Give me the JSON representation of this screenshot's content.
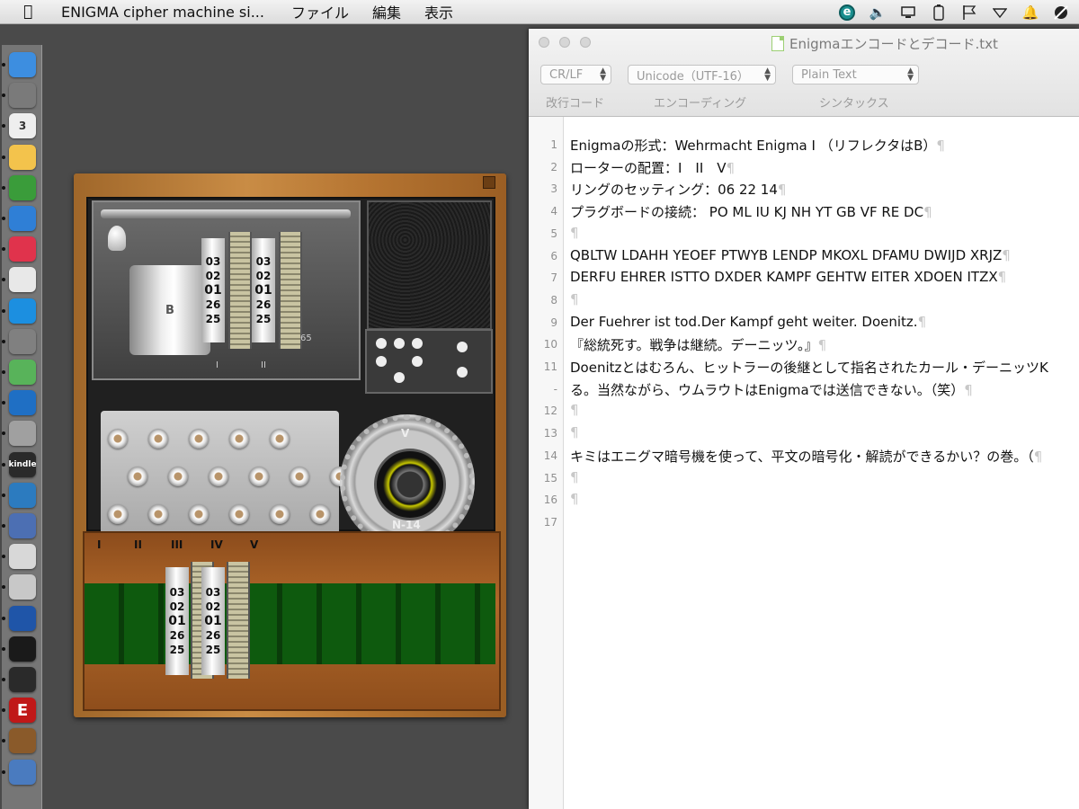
{
  "menubar": {
    "app_name": "ENIGMA cipher machine si...",
    "menus": [
      "ファイル",
      "編集",
      "表示"
    ]
  },
  "tray_icons": [
    "e-status-icon",
    "volume-icon",
    "monitor-icon",
    "battery-icon",
    "flag-icon",
    "wifi-icon",
    "notification-bell-icon",
    "user-tools-icon"
  ],
  "dock": {
    "apps": [
      "finder-icon",
      "launchpad-icon",
      "calendar-icon",
      "textedit-icon",
      "numbers-icon",
      "keynote-icon",
      "itunes-icon",
      "chrome-icon",
      "app-store-icon",
      "system-preferences-icon",
      "maps-icon",
      "thunderbird-icon",
      "disk-utility-icon",
      "kindle-icon",
      "xcode-icon",
      "remote-desktop-icon",
      "notes-icon",
      "preview-icon",
      "mapping-icon",
      "terminal-icon",
      "activity-monitor-icon",
      "enigma-app-icon",
      "instruments-icon",
      "image-capture-icon"
    ],
    "calendar_day": "3",
    "kindle_label": "kindle",
    "enigma_letter": "E"
  },
  "enigma": {
    "reflector": "B",
    "rotor_values": [
      "03",
      "02",
      "01",
      "26",
      "25"
    ],
    "rotor_labels": [
      "I",
      "II"
    ],
    "window_rotor": "V",
    "gear_label": "N-14",
    "panel_count": "65",
    "drawer_labels": [
      "I",
      "II",
      "III",
      "IV",
      "V"
    ]
  },
  "editor": {
    "title": "Enigmaエンコードとデコード.txt",
    "popups": {
      "line_ending": "CR/LF",
      "encoding": "Unicode（UTF-16）",
      "syntax": "Plain Text"
    },
    "popup_labels": {
      "line_ending": "改行コード",
      "encoding": "エンコーディング",
      "syntax": "シンタックス"
    },
    "line_numbers": [
      "1",
      "2",
      "3",
      "4",
      "5",
      "6",
      "7",
      "8",
      "9",
      "10",
      "11",
      "-",
      "12",
      "13",
      "14",
      "15",
      "16",
      "17"
    ],
    "lines": [
      "Enigmaの形式：Wehrmacht Enigma I （リフレクタはB）",
      "ローターの配置：I　II　V",
      "リングのセッティング：06 22 14",
      "プラグボードの接続： PO ML IU KJ NH YT GB VF RE DC",
      "",
      "QBLTW LDAHH YEOEF PTWYB LENDP MKOXL DFAMU DWIJD XRJZ",
      "DERFU EHRER ISTTO DXDER KAMPF GEHTW EITER XDOEN ITZX",
      "",
      "Der Fuehrer ist tod.Der Kampf geht weiter. Doenitz.",
      "『総統死す。戦争は継続。デーニッツ。』",
      "Doenitzとはむろん、ヒットラーの後継として指名されたカール・デーニッツK",
      "る。当然ながら、ウムラウトはEnigmaでは送信できない。（笑）",
      "",
      "",
      "キミはエニグマ暗号機を使って、平文の暗号化・解読ができるかい？の巻。（",
      "",
      "",
      ""
    ],
    "pilcrow": "¶"
  }
}
